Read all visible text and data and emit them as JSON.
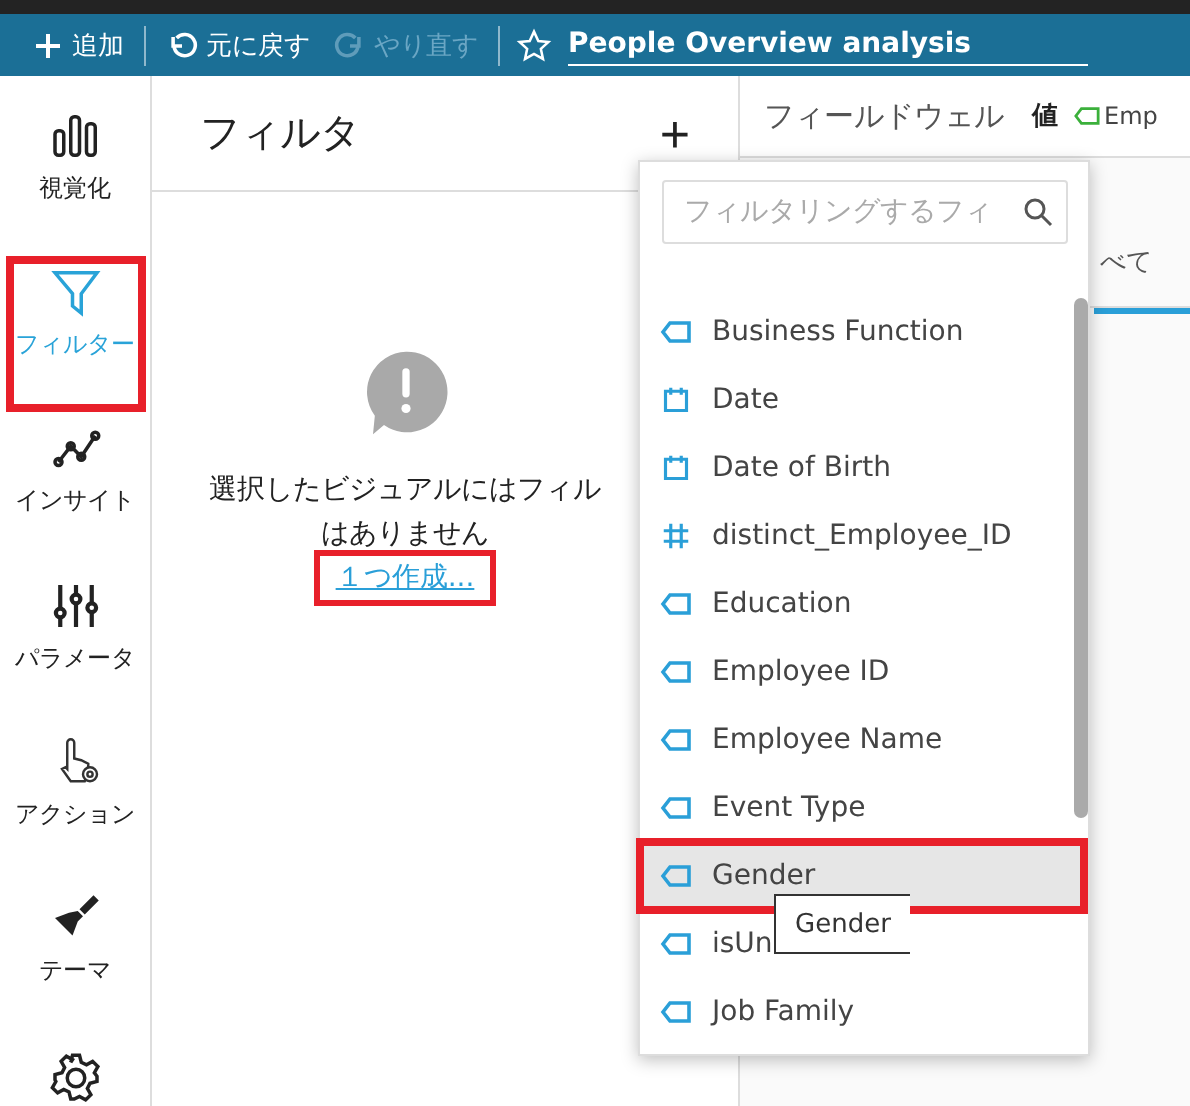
{
  "toolbar": {
    "add": "追加",
    "undo": "元に戻す",
    "redo": "やり直す",
    "redo_disabled": true,
    "title": "People Overview analysis",
    "favorite": false
  },
  "sidebar": {
    "items": [
      {
        "label": "視覚化",
        "selected": false,
        "highlighted": false
      },
      {
        "label": "フィルター",
        "selected": true,
        "highlighted": true
      },
      {
        "label": "インサイト",
        "selected": false,
        "highlighted": false
      },
      {
        "label": "パラメータ",
        "selected": false,
        "highlighted": false
      },
      {
        "label": "アクション",
        "selected": false,
        "highlighted": false
      },
      {
        "label": "テーマ",
        "selected": false,
        "highlighted": false
      }
    ]
  },
  "filter_panel": {
    "title": "フィルタ",
    "add": "+",
    "message_lines": [
      "選択したビジュアルにはフィル",
      "はありません"
    ],
    "create_link": "１つ作成...",
    "create_link_highlighted": true
  },
  "field_wells": {
    "title": "フィールドウェル",
    "value_label": "値",
    "value_field": "Emp",
    "tab_text": "べて"
  },
  "field_dropdown": {
    "search_placeholder": "フィルタリングするフィ",
    "fields": [
      {
        "name": "Business Function",
        "kind": "string",
        "selected": false,
        "highlighted": false
      },
      {
        "name": "Date",
        "kind": "date",
        "selected": false,
        "highlighted": false
      },
      {
        "name": "Date of Birth",
        "kind": "date",
        "selected": false,
        "highlighted": false
      },
      {
        "name": "distinct_Employee_ID",
        "kind": "number",
        "selected": false,
        "highlighted": false
      },
      {
        "name": "Education",
        "kind": "string",
        "selected": false,
        "highlighted": false
      },
      {
        "name": "Employee ID",
        "kind": "string",
        "selected": false,
        "highlighted": false
      },
      {
        "name": "Employee Name",
        "kind": "string",
        "selected": false,
        "highlighted": false
      },
      {
        "name": "Event Type",
        "kind": "string",
        "selected": false,
        "highlighted": false
      },
      {
        "name": "Gender",
        "kind": "string",
        "selected": true,
        "highlighted": true
      },
      {
        "name": "isUn",
        "kind": "string",
        "selected": false,
        "highlighted": false
      },
      {
        "name": "Job Family",
        "kind": "string",
        "selected": false,
        "highlighted": false
      }
    ],
    "tooltip": "Gender"
  }
}
